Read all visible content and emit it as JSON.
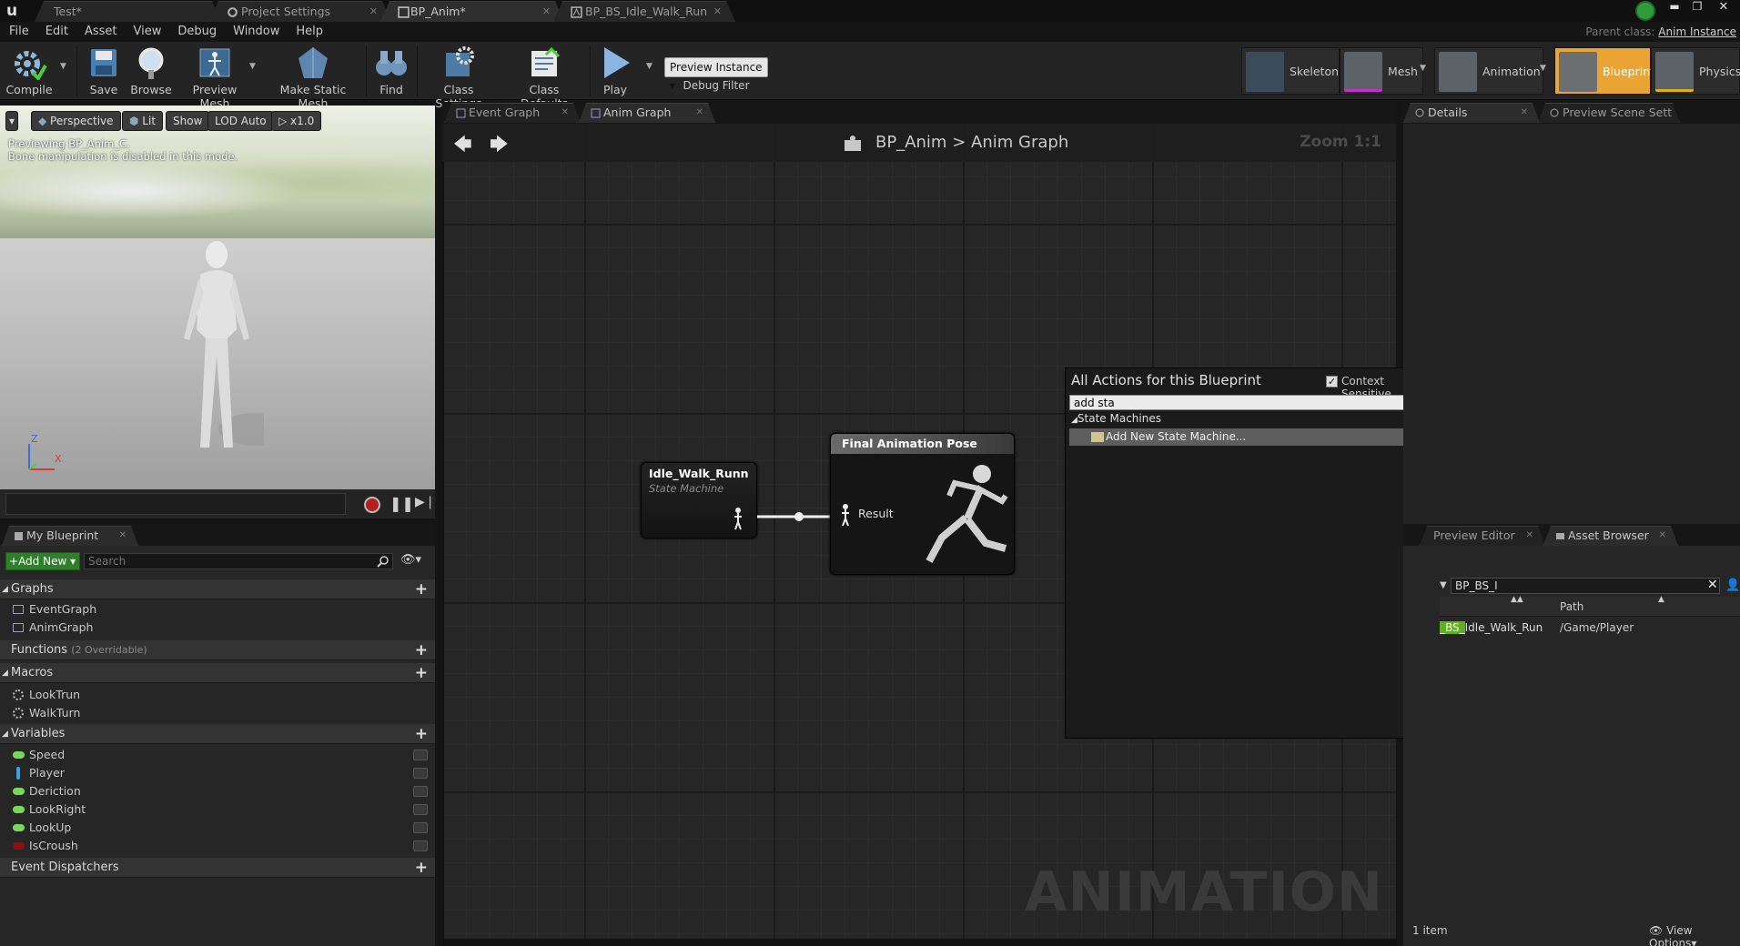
{
  "titlebar": {
    "tabs": [
      "Test*",
      "Project Settings",
      "BP_Anim*",
      "BP_BS_Idle_Walk_Run"
    ],
    "parent_class_label": "Parent class:",
    "parent_class_value": "Anim Instance"
  },
  "menu": [
    "File",
    "Edit",
    "Asset",
    "View",
    "Debug",
    "Window",
    "Help"
  ],
  "toolbar": {
    "buttons": [
      "Compile",
      "Save",
      "Browse",
      "Preview Mesh",
      "Make Static Mesh",
      "Find",
      "Class Settings",
      "Class Defaults",
      "Play"
    ],
    "preview_instance": "Preview Instance",
    "debug_filter": "Debug Filter",
    "modes": [
      "Skeleton",
      "Mesh",
      "Animation",
      "Blueprint",
      "Physics"
    ]
  },
  "viewport": {
    "buttons": [
      "Perspective",
      "Lit",
      "Show",
      "LOD Auto",
      "x1.0"
    ],
    "note1": "Previewing BP_Anim_C.",
    "note2": "Bone manipulation is disabled in this mode.",
    "axis_z": "Z",
    "axis_x": "X"
  },
  "graph_tabs": [
    "Event Graph",
    "Anim Graph"
  ],
  "graph": {
    "breadcrumb_root": "BP_Anim",
    "breadcrumb_sep": ">",
    "breadcrumb_leaf": "Anim Graph",
    "zoom": "Zoom 1:1",
    "watermark": "ANIMATION"
  },
  "nodes": {
    "state_machine": {
      "title": "Idle_Walk_Runn",
      "subtitle": "State Machine"
    },
    "final_pose": {
      "title": "Final Animation Pose",
      "pin": "Result"
    }
  },
  "context_menu": {
    "title": "All Actions for this Blueprint",
    "context_sensitive": "Context Sensitive",
    "search_value": "add sta",
    "category": "State Machines",
    "item": "Add New State Machine..."
  },
  "myblueprint": {
    "tab": "My Blueprint",
    "add_new": "Add New",
    "search_placeholder": "Search",
    "graphs_label": "Graphs",
    "graphs": [
      "EventGraph",
      "AnimGraph"
    ],
    "functions_label": "Functions",
    "functions_sub": "(2 Overridable)",
    "macros_label": "Macros",
    "macros": [
      "LookTrun",
      "WalkTurn"
    ],
    "variables_label": "Variables",
    "variables": [
      {
        "name": "Speed",
        "color": "#7ad65c"
      },
      {
        "name": "Player",
        "color": "#3aa3e0"
      },
      {
        "name": "Deriction",
        "color": "#7ad65c"
      },
      {
        "name": "LookRight",
        "color": "#7ad65c"
      },
      {
        "name": "LookUp",
        "color": "#7ad65c"
      },
      {
        "name": "IsCroush",
        "color": "#8a1010"
      }
    ],
    "dispatchers_label": "Event Dispatchers"
  },
  "right": {
    "details_tab": "Details",
    "preview_tab": "Preview Scene Sett",
    "preview_editor_tab": "Preview Editor",
    "asset_browser_tab": "Asset Browser",
    "asset_search": "BP_BS_I",
    "path_header": "Path",
    "asset_name_hl": "_BS_",
    "asset_name_rest": "Idle_Walk_Run",
    "asset_path": "/Game/Player",
    "item_count": "1 item",
    "view_options": "View Options"
  }
}
